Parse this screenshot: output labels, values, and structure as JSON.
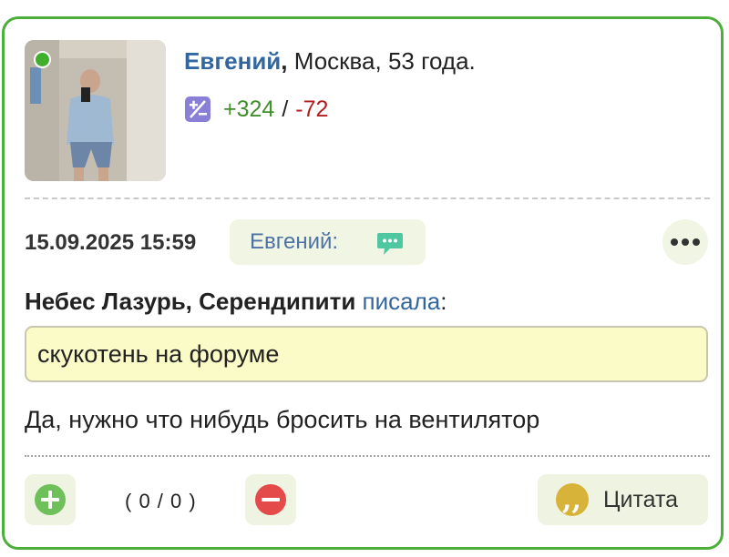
{
  "user": {
    "name": "Евгений",
    "separator": ",",
    "meta": " Москва, 53 года.",
    "online": true,
    "rating": {
      "plus": "+324",
      "slash": "/",
      "minus": "-72"
    }
  },
  "post": {
    "date": "15.09.2025 15:59",
    "reply_to_label": "Евгений:",
    "quote_authors": "Небес Лазурь, Серендипити",
    "quote_wrote": "писала",
    "quote_colon": ":",
    "quote_text": "скукотень на форуме",
    "message": "Да, нужно что нибудь бросить на вентилятор"
  },
  "actions": {
    "vote_count": "( 0 / 0 )",
    "quote_label": "Цитата"
  },
  "colors": {
    "card_border": "#4caf3a",
    "link": "#33669e",
    "rating_plus": "#3f8f2a",
    "rating_minus": "#b01e1e",
    "quote_bg": "#fbfbc8",
    "chip_bg": "#f1f5e3"
  },
  "icons": {
    "online": "online-dot-icon",
    "rating": "plus-minus-icon",
    "reply": "chat-bubble-icon",
    "more": "more-dots-icon",
    "vote_up": "plus-circle-icon",
    "vote_down": "minus-circle-icon",
    "quote": "quote-marks-icon"
  }
}
